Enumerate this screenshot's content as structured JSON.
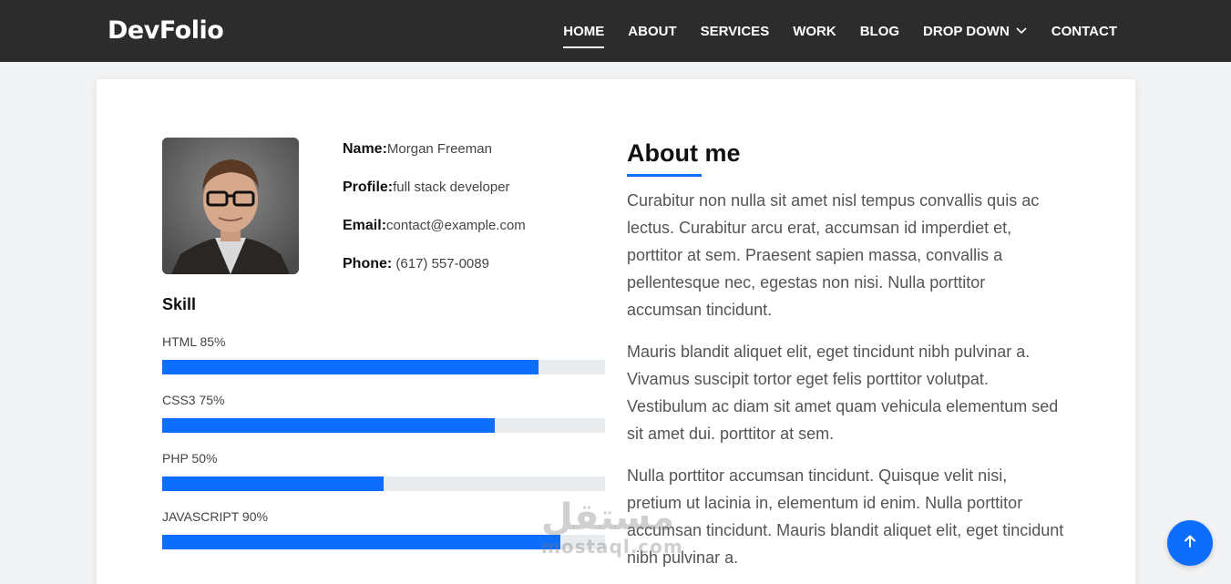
{
  "brand": "DevFolio",
  "nav": {
    "home": "HOME",
    "about": "ABOUT",
    "services": "SERVICES",
    "work": "WORK",
    "blog": "BLOG",
    "dropdown": "DROP DOWN",
    "contact": "CONTACT"
  },
  "profile": {
    "name_label": "Name:",
    "name_value": "Morgan Freeman",
    "profile_label": "Profile:",
    "profile_value": "full stack developer",
    "email_label": "Email:",
    "email_value": "contact@example.com",
    "phone_label": "Phone:",
    "phone_value": " (617) 557-0089"
  },
  "skills": {
    "title": "Skill",
    "items": [
      {
        "label": "HTML 85%",
        "percent": 85
      },
      {
        "label": "CSS3 75%",
        "percent": 75
      },
      {
        "label": "PHP 50%",
        "percent": 50
      },
      {
        "label": "JAVASCRIPT 90%",
        "percent": 90
      }
    ]
  },
  "about": {
    "title": "About me",
    "p1": "Curabitur non nulla sit amet nisl tempus convallis quis ac lectus. Curabitur arcu erat, accumsan id imperdiet et, porttitor at sem. Praesent sapien massa, convallis a pellentesque nec, egestas non nisi. Nulla porttitor accumsan tincidunt.",
    "p2": "Mauris blandit aliquet elit, eget tincidunt nibh pulvinar a. Vivamus suscipit tortor eget felis porttitor volutpat. Vestibulum ac diam sit amet quam vehicula elementum sed sit amet dui. porttitor at sem.",
    "p3": "Nulla porttitor accumsan tincidunt. Quisque velit nisi, pretium ut lacinia in, elementum id enim. Nulla porttitor accumsan tincidunt. Mauris blandit aliquet elit, eget tincidunt nibh pulvinar a."
  },
  "watermark": {
    "arabic": "مستقل",
    "latin": "mostaql.com"
  },
  "colors": {
    "accent": "#0d6efd",
    "navbar": "#2c2c2c",
    "bar_track": "#e9ecef"
  },
  "icons": {
    "dropdown": "chevron-down-icon",
    "back_to_top": "arrow-up-icon"
  }
}
